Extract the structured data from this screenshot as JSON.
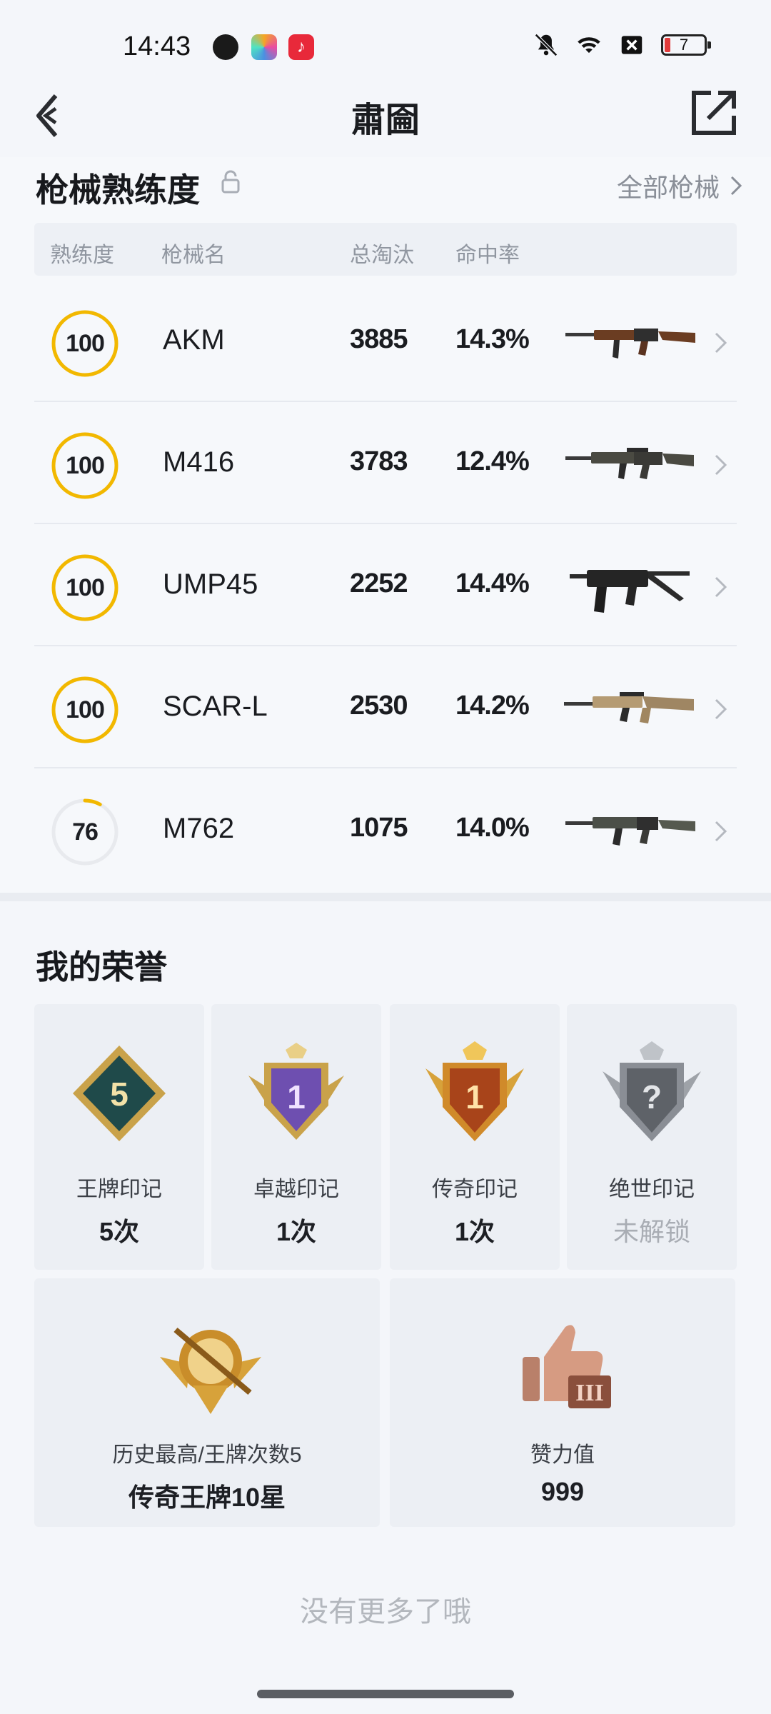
{
  "status_bar": {
    "time": "14:43",
    "battery": "7",
    "icons": [
      "mute-icon",
      "wifi-icon",
      "sim-off-icon",
      "battery-icon"
    ]
  },
  "header": {
    "title": "肅圇",
    "back_icon": "back-arrow-icon",
    "share_icon": "share-icon"
  },
  "weapons": {
    "title": "枪械熟练度",
    "all_link": "全部枪械",
    "columns": [
      "熟练度",
      "枪械名",
      "总淘汰",
      "命中率"
    ],
    "rows": [
      {
        "proficiency": "100",
        "proficiency_pct": 100,
        "name": "AKM",
        "kills": "3885",
        "accuracy": "14.3%"
      },
      {
        "proficiency": "100",
        "proficiency_pct": 100,
        "name": "M416",
        "kills": "3783",
        "accuracy": "12.4%"
      },
      {
        "proficiency": "100",
        "proficiency_pct": 100,
        "name": "UMP45",
        "kills": "2252",
        "accuracy": "14.4%"
      },
      {
        "proficiency": "100",
        "proficiency_pct": 100,
        "name": "SCAR-L",
        "kills": "2530",
        "accuracy": "14.2%"
      },
      {
        "proficiency": "76",
        "proficiency_pct": 8,
        "name": "M762",
        "kills": "1075",
        "accuracy": "14.0%"
      }
    ]
  },
  "honor": {
    "title": "我的荣誉",
    "badges": [
      {
        "label": "王牌印记",
        "value": "5次",
        "emblem_text": "5"
      },
      {
        "label": "卓越印记",
        "value": "1次",
        "emblem_text": "1"
      },
      {
        "label": "传奇印记",
        "value": "1次",
        "emblem_text": "1"
      },
      {
        "label": "绝世印记",
        "value": "未解锁",
        "emblem_text": "?"
      }
    ],
    "history": {
      "label": "历史最高/王牌次数5",
      "value": "传奇王牌10星"
    },
    "likes": {
      "label": "赞力值",
      "value": "999"
    }
  },
  "footer": {
    "no_more": "没有更多了哦"
  },
  "colors": {
    "ring": "#f2b800",
    "ring_track": "#e8eaee",
    "background": "#f4f6fa"
  }
}
